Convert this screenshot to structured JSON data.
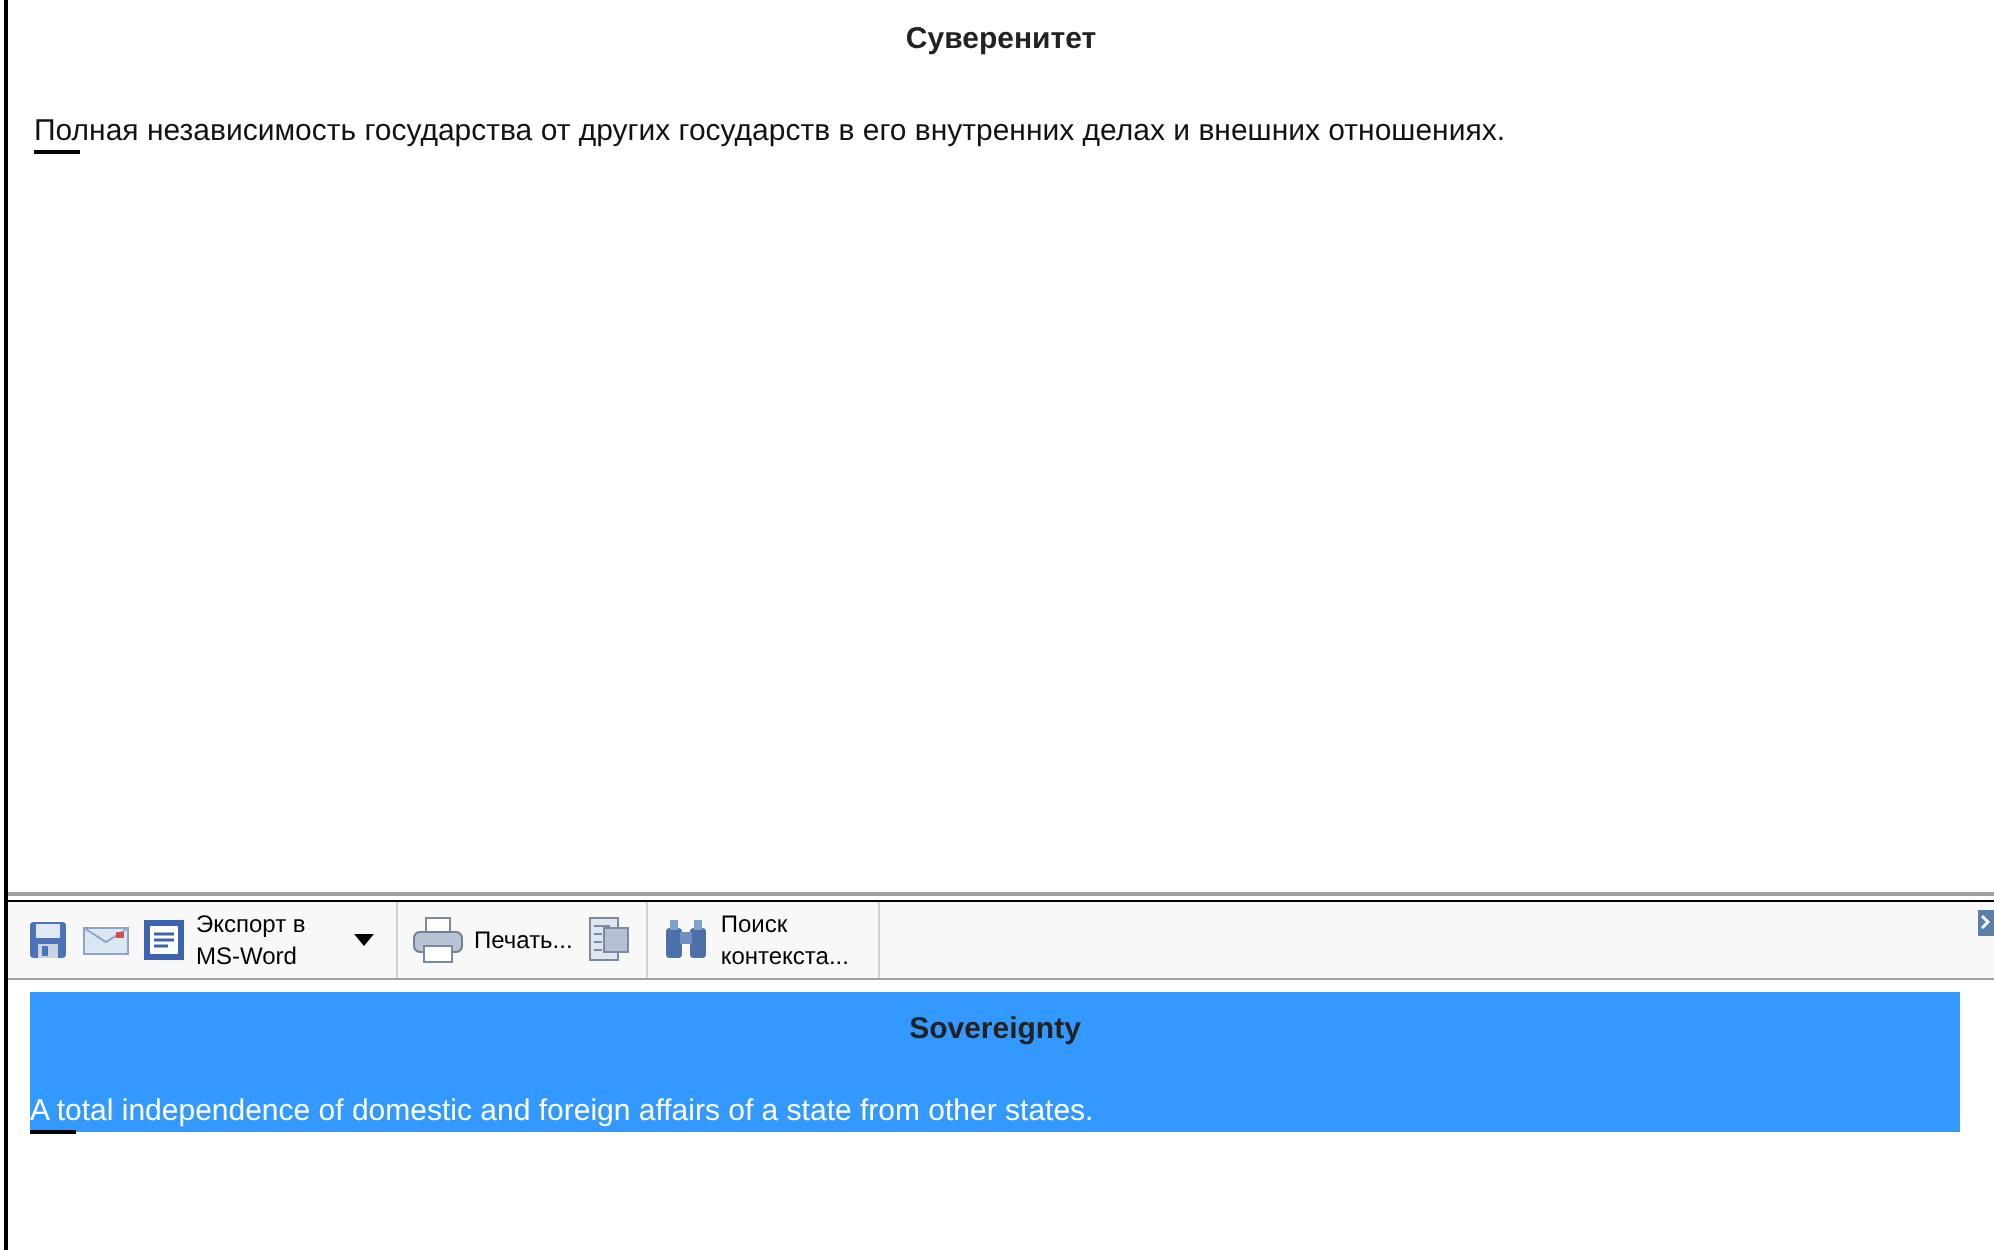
{
  "article": {
    "title": "Суверенитет",
    "text": "Полная независимость государства от других государств в его внутренних делах и внешних отношениях."
  },
  "toolbar": {
    "items": [
      {
        "kind": "save"
      },
      {
        "kind": "mail"
      },
      {
        "kind": "word",
        "label": "Экспорт в MS-Word",
        "dropdown": true
      },
      {
        "kind": "separator"
      },
      {
        "kind": "print",
        "label": "Печать..."
      },
      {
        "kind": "preview"
      },
      {
        "kind": "separator"
      },
      {
        "kind": "search",
        "label": "Поиск контекста..."
      },
      {
        "kind": "separator"
      }
    ]
  },
  "translation": {
    "title": "Sovereignty",
    "text": "A total independence of domestic and foreign affairs of a state from other states.",
    "selected": true
  }
}
